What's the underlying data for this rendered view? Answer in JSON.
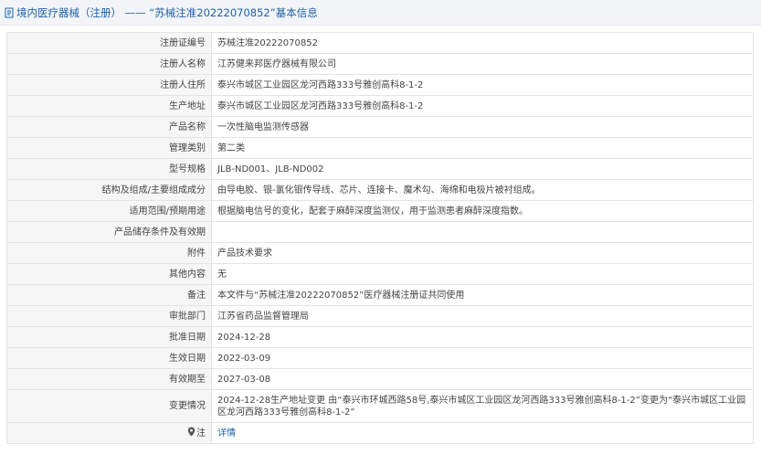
{
  "header": {
    "title": "境内医疗器械（注册） —— “苏械注准20222070852”基本信息"
  },
  "rows": [
    {
      "label": "注册证编号",
      "value": "苏械注准20222070852"
    },
    {
      "label": "注册人名称",
      "value": "江苏健来邦医疗器械有限公司"
    },
    {
      "label": "注册人住所",
      "value": "泰兴市城区工业园区龙河西路333号雅创高科8-1-2"
    },
    {
      "label": "生产地址",
      "value": "泰兴市城区工业园区龙河西路333号雅创高科8-1-2"
    },
    {
      "label": "产品名称",
      "value": "一次性脑电监测传感器"
    },
    {
      "label": "管理类别",
      "value": "第二类"
    },
    {
      "label": "型号规格",
      "value": "JLB-ND001、JLB-ND002"
    },
    {
      "label": "结构及组成/主要组成成分",
      "value": "由导电胶、银-氯化银传导线、芯片、连接卡、魔术勾、海绵和电极片被衬组成。"
    },
    {
      "label": "适用范围/预期用途",
      "value": "根据脑电信号的变化，配套于麻醉深度监测仪，用于监测患者麻醉深度指数。"
    },
    {
      "label": "产品储存条件及有效期",
      "value": ""
    },
    {
      "label": "附件",
      "value": "产品技术要求"
    },
    {
      "label": "其他内容",
      "value": "无"
    },
    {
      "label": "备注",
      "value": "本文件与“苏械注准20222070852”医疗器械注册证共同使用"
    },
    {
      "label": "审批部门",
      "value": "江苏省药品监督管理局"
    },
    {
      "label": "批准日期",
      "value": "2024-12-28"
    },
    {
      "label": "生效日期",
      "value": "2022-03-09"
    },
    {
      "label": "有效期至",
      "value": "2027-03-08"
    },
    {
      "label": "变更情况",
      "value": "2024-12-28生产地址变更 由“泰兴市环城西路58号,泰兴市城区工业园区龙河西路333号雅创高科8-1-2”变更为“泰兴市城区工业园区龙河西路333号雅创高科8-1-2”"
    }
  ],
  "footer_row": {
    "label": "注",
    "link_text": "详情"
  }
}
